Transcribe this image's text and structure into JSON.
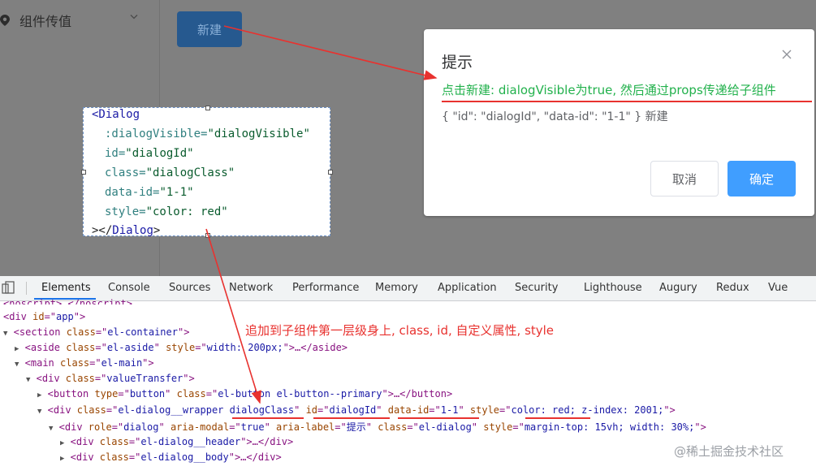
{
  "app": {
    "menu_label": "组件传值",
    "new_button": "新建"
  },
  "dialog": {
    "title": "提示",
    "message_green": "点击新建: dialogVisible为true, 然后通过props传递给子组件",
    "body": "{ \"id\": \"dialogId\", \"data-id\": \"1-1\" } 新建",
    "cancel": "取消",
    "confirm": "确定"
  },
  "code_snippet": {
    "l1_tag": "<Dialog",
    "l2_attr": ":dialogVisible=",
    "l2_val": "\"dialogVisible\"",
    "l3_attr": "id=",
    "l3_val": "\"dialogId\"",
    "l4_attr": "class=",
    "l4_val": "\"dialogClass\"",
    "l5_attr": "data-id=",
    "l5_val": "\"1-1\"",
    "l6_attr": "style=",
    "l6_val": "\"color: red\"",
    "l7_a": "></",
    "l7_b": "Dialog",
    "l7_c": ">"
  },
  "devtools": {
    "tabs": [
      "Elements",
      "Console",
      "Sources",
      "Network",
      "Performance",
      "Memory",
      "Application",
      "Security",
      "Lighthouse",
      "Augury",
      "Redux",
      "Vue"
    ],
    "annotation": "追加到子组件第一层级身上, class, id, 自定义属性, style",
    "watermark": "@稀土掘金技术社区",
    "lines": {
      "l0": "<noscript>…</noscript>",
      "l1a": "<div ",
      "l1b": "id",
      "l1c": "=\"",
      "l1d": "app",
      "l1e": "\">",
      "l2a": "<section ",
      "l2b": "class",
      "l2c": "=\"",
      "l2d": "el-container",
      "l2e": "\">",
      "l3a": "<aside ",
      "l3b": "class",
      "l3c": "=\"",
      "l3d": "el-aside",
      "l3e": "\" ",
      "l3f": "style",
      "l3g": "=\"",
      "l3h": "width: 200px;",
      "l3i": "\">…</aside>",
      "l4a": "<main ",
      "l4b": "class",
      "l4c": "=\"",
      "l4d": "el-main",
      "l4e": "\">",
      "l5a": "<div ",
      "l5b": "class",
      "l5c": "=\"",
      "l5d": "valueTransfer",
      "l5e": "\">",
      "l6a": "<button ",
      "l6b": "type",
      "l6c": "=\"",
      "l6d": "button",
      "l6e": "\" ",
      "l6f": "class",
      "l6g": "=\"",
      "l6h": "el-button el-button--primary",
      "l6i": "\">…</button>",
      "l7a": "<div ",
      "l7b": "class",
      "l7c": "=\"",
      "l7d": "el-dialog__wrapper dialogClass",
      "l7e": "\" ",
      "l7f": "id",
      "l7g": "=\"",
      "l7h": "dialogId",
      "l7i": "\" ",
      "l7j": "data-id",
      "l7k": "=\"",
      "l7l": "1-1",
      "l7m": "\" ",
      "l7n": "style",
      "l7o": "=\"",
      "l7p": "color: red; z-index: 2001;",
      "l7q": "\">",
      "l8a": "<div ",
      "l8b": "role",
      "l8c": "=\"",
      "l8d": "dialog",
      "l8e": "\" ",
      "l8f": "aria-modal",
      "l8g": "=\"",
      "l8h": "true",
      "l8i": "\" ",
      "l8j": "aria-label",
      "l8k": "=\"",
      "l8l": "提示",
      "l8m": "\" ",
      "l8n": "class",
      "l8o": "=\"",
      "l8p": "el-dialog",
      "l8q": "\" ",
      "l8r": "style",
      "l8s": "=\"",
      "l8t": "margin-top: 15vh; width: 30%;",
      "l8u": "\">",
      "l9a": "<div ",
      "l9b": "class",
      "l9c": "=\"",
      "l9d": "el-dialog__header",
      "l9e": "\">…</div>",
      "l10a": "<div ",
      "l10b": "class",
      "l10c": "=\"",
      "l10d": "el-dialog__body",
      "l10e": "\">…</div>"
    }
  },
  "colors": {
    "overlay": "#808080",
    "primary": "#409eff",
    "annotation_red": "#e8322f",
    "green_text": "#22b14c"
  }
}
